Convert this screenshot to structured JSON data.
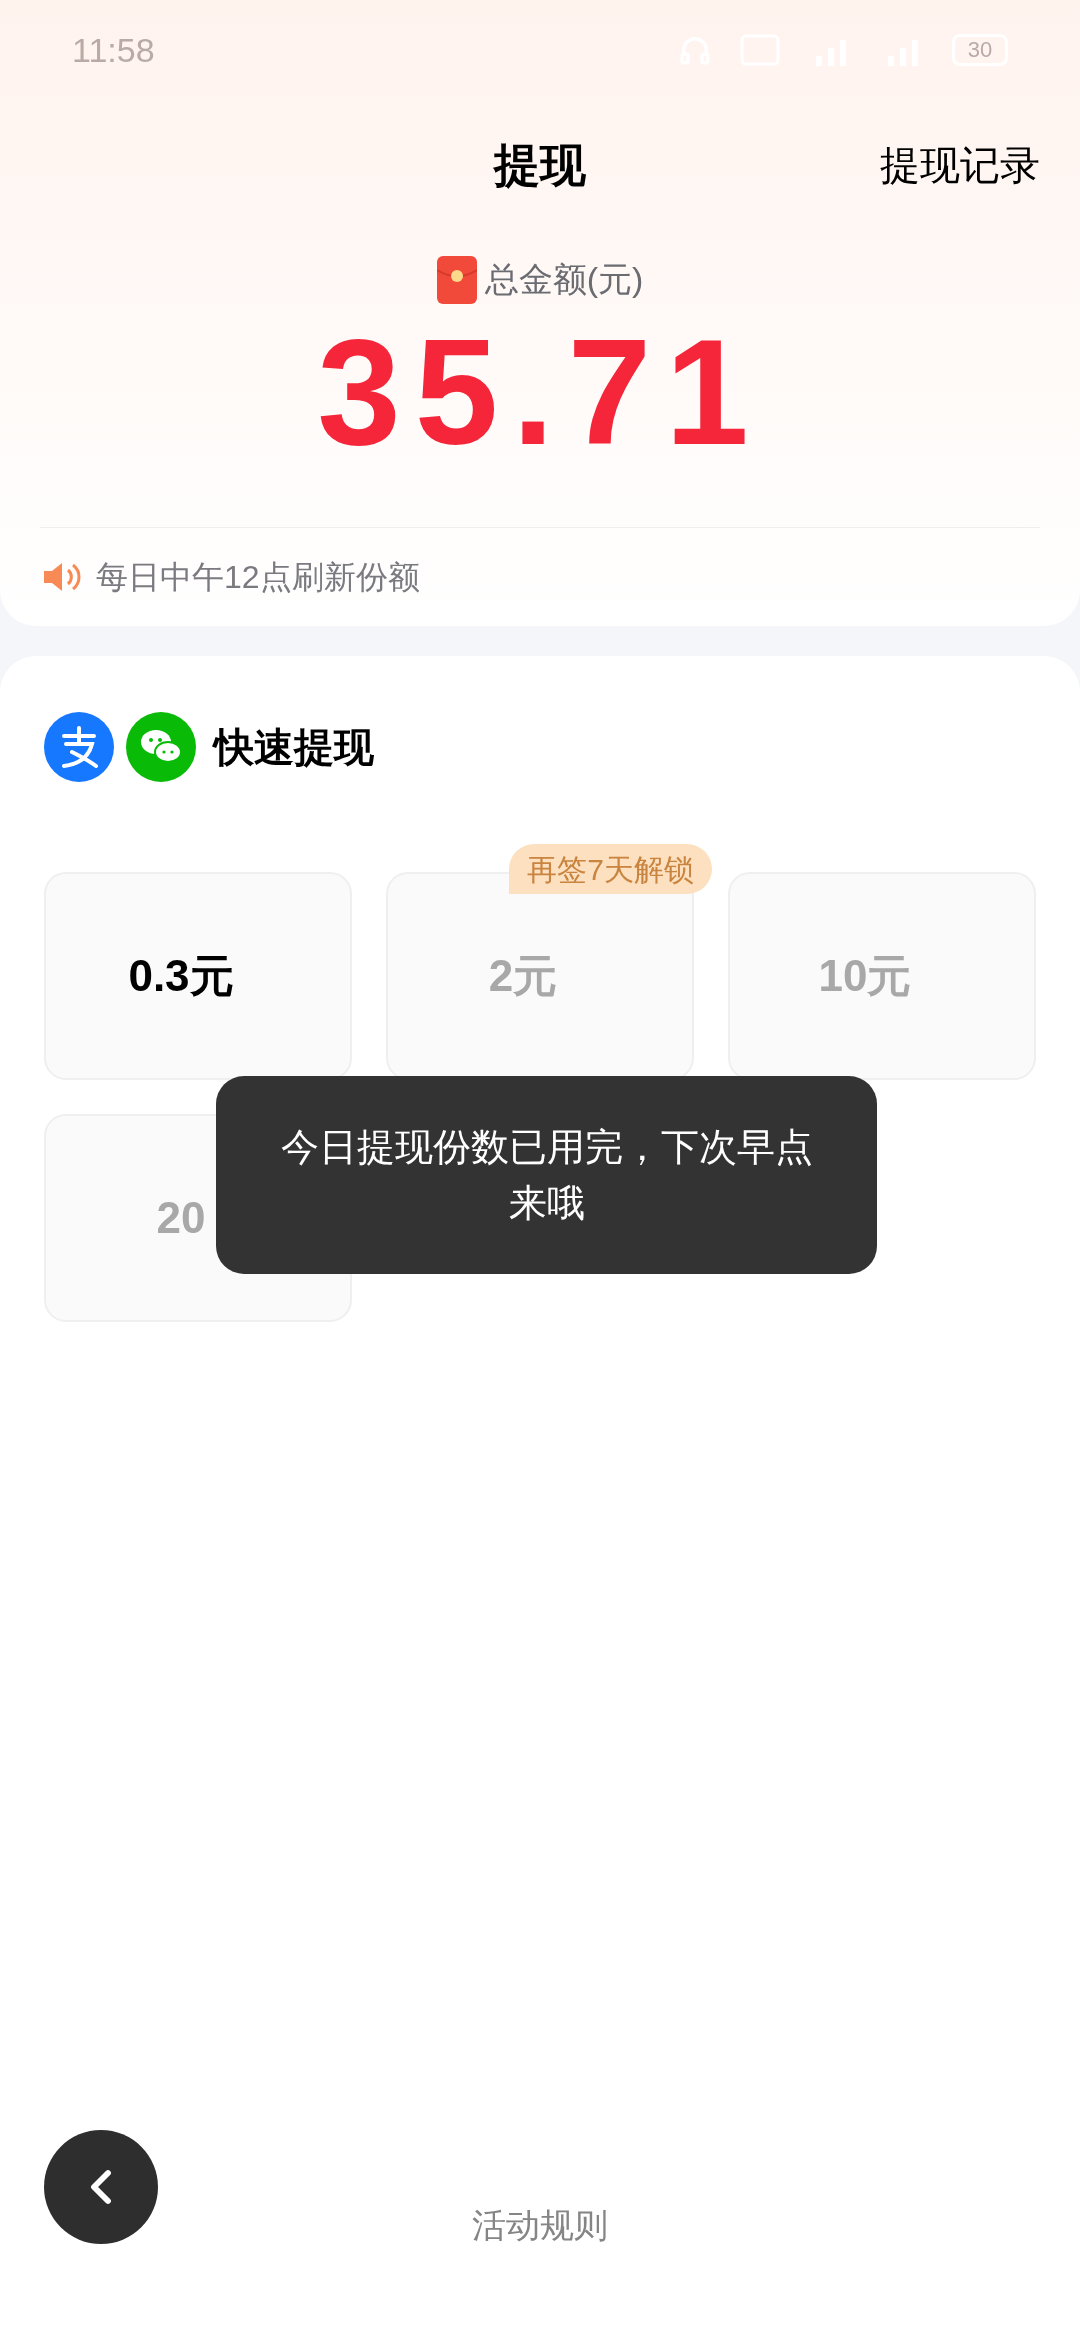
{
  "status_bar": {
    "time": "11:58",
    "battery": "30"
  },
  "header": {
    "title": "提现",
    "action": "提现记录"
  },
  "balance": {
    "label": "总金额(元)",
    "amount": "35.71"
  },
  "notice": "每日中午12点刷新份额",
  "quick_withdraw": {
    "title": "快速提现",
    "options": [
      {
        "amount": "0.3元",
        "disabled": false
      },
      {
        "amount": "2元",
        "disabled": true,
        "badge": "再签7天解锁"
      },
      {
        "amount": "10元",
        "disabled": true
      },
      {
        "amount": "20",
        "disabled": true
      }
    ]
  },
  "toast": "今日提现份数已用完，下次早点来哦",
  "footer": {
    "rules_link": "活动规则"
  }
}
